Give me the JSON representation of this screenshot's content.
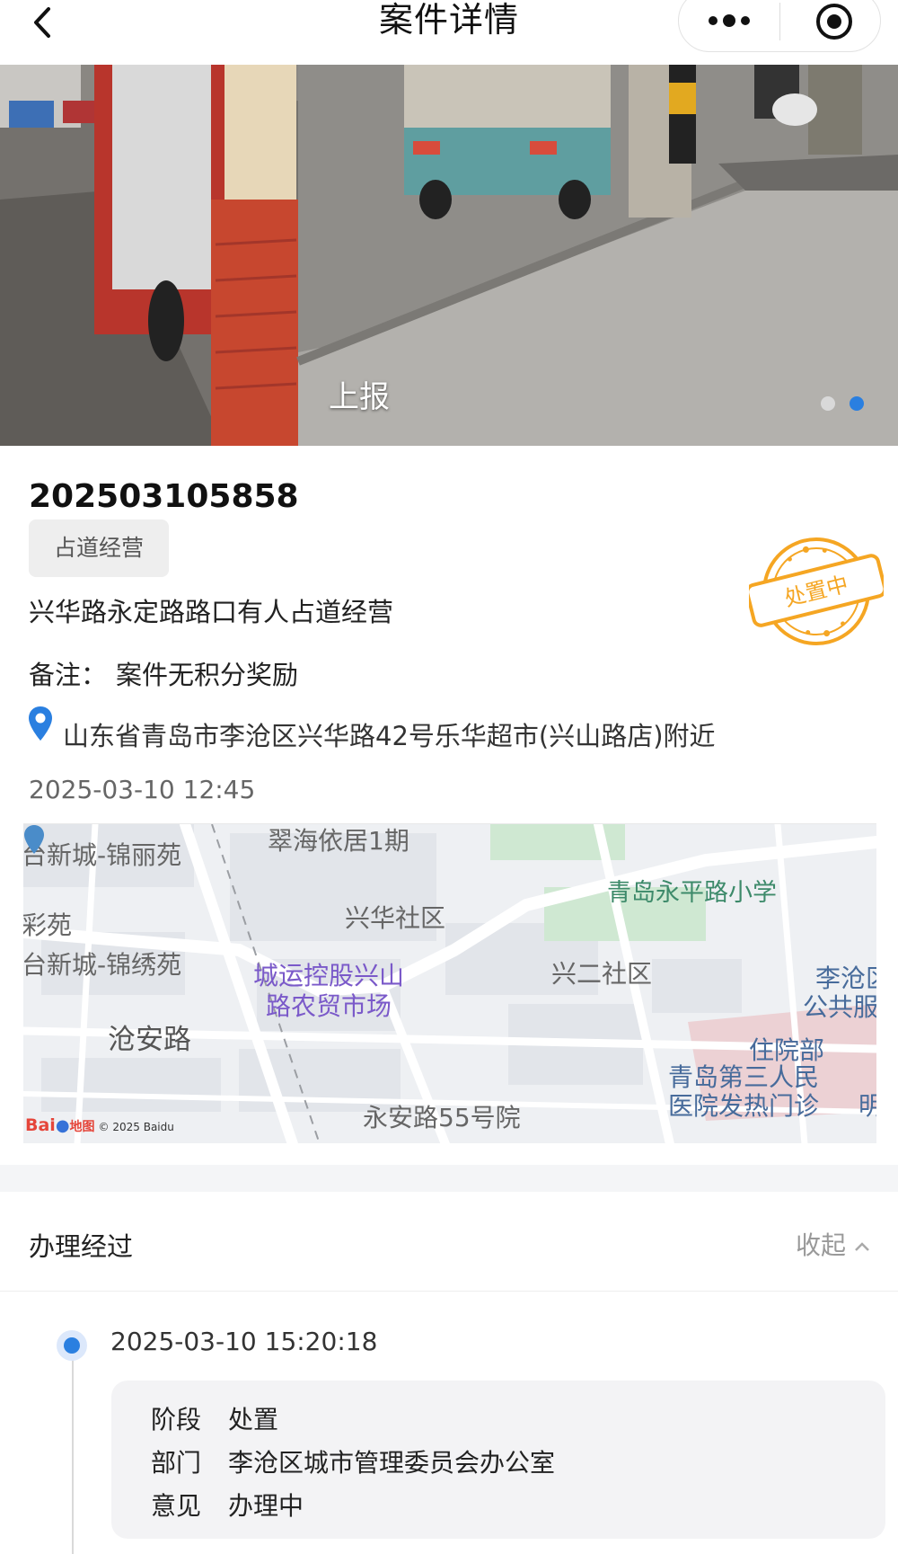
{
  "header": {
    "title": "案件详情",
    "back_icon": "chevron-left-icon",
    "more_icon": "more-dots-icon",
    "close_icon": "target-icon"
  },
  "carousel": {
    "caption": "上报",
    "slide_count": 2,
    "active_index": 1
  },
  "case": {
    "number": "202503105858",
    "category_tag": "占道经营",
    "description": "兴华路永定路路口有人占道经营",
    "remark_label": "备注：",
    "remark_value": "案件无积分奖励",
    "address": "山东省青岛市李沧区兴华路42号乐华超市(兴山路店)附近",
    "datetime": "2025-03-10 12:45",
    "status_stamp": "处置中",
    "status_color": "#f5a623"
  },
  "map": {
    "labels": {
      "l1": "翠海依居1期",
      "l2": "台新城-锦丽苑",
      "l3": "青岛永平路小学",
      "l4": "兴华社区",
      "l5": "彩苑",
      "l6": "台新城-锦绣苑",
      "l7a": "城运控股兴山",
      "l7b": "路农贸市场",
      "l8": "兴二社区",
      "l9a": "李沧区",
      "l9b": "公共服务",
      "l10": "沧安路",
      "l11": "住院部",
      "l12a": "青岛第三人民",
      "l12b": "医院发热门诊",
      "l13": "永安路55号院",
      "l14": "明"
    },
    "logo_text": "Bai",
    "logo_map": "地图",
    "copyright": "© 2025 Baidu"
  },
  "process": {
    "title": "办理经过",
    "collapse_label": "收起",
    "steps": [
      {
        "time": "2025-03-10 15:20:18",
        "stage_label": "阶段",
        "stage": "处置",
        "dept_label": "部门",
        "dept": "李沧区城市管理委员会办公室",
        "opinion_label": "意见",
        "opinion": "办理中"
      }
    ]
  }
}
